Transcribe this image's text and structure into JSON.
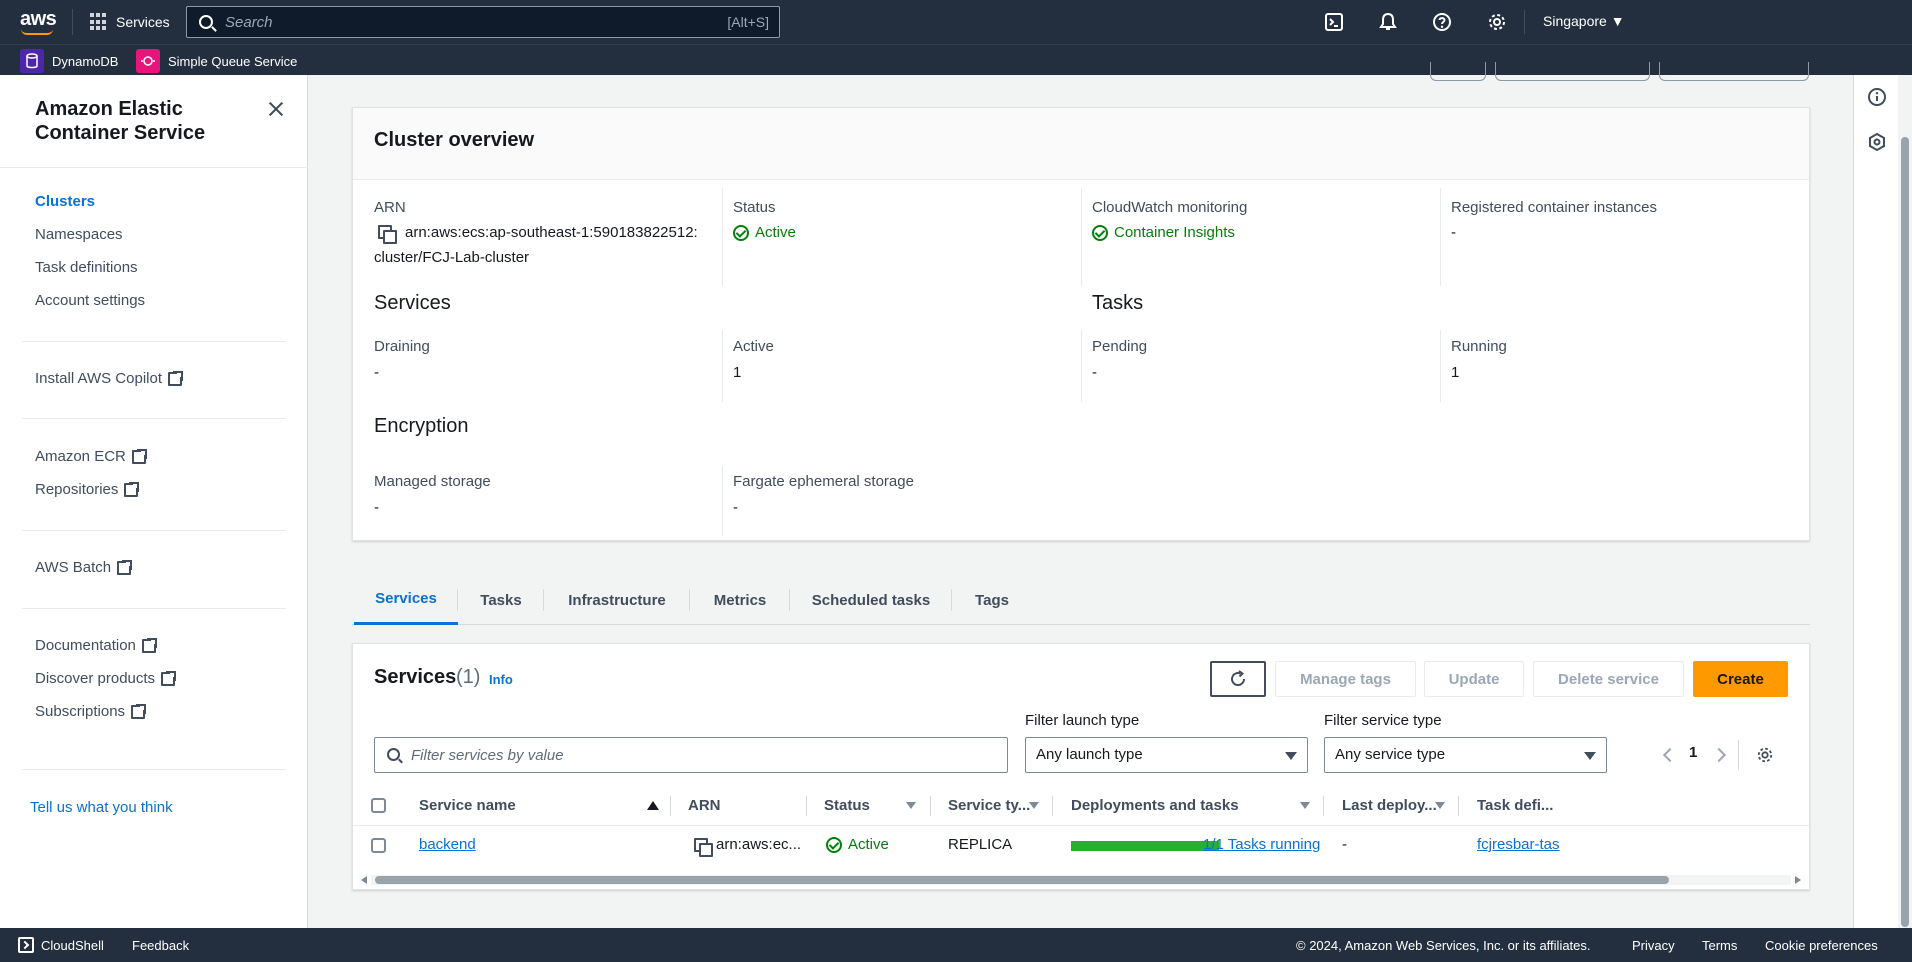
{
  "topnav": {
    "logo": "aws",
    "services_label": "Services",
    "search_placeholder": "Search",
    "search_shortcut": "[Alt+S]",
    "region": "Singapore ▼",
    "icons": [
      "cloudshell-icon",
      "bell-icon",
      "help-icon",
      "gear-icon"
    ]
  },
  "favorites": [
    {
      "label": "DynamoDB",
      "color": "#4d27aa"
    },
    {
      "label": "Simple Queue Service",
      "color": "#e7157b"
    }
  ],
  "sidebar": {
    "title": "Amazon Elastic Container Service",
    "nav": [
      "Clusters",
      "Namespaces",
      "Task definitions",
      "Account settings"
    ],
    "copilot": "Install AWS Copilot",
    "ecr": [
      "Amazon ECR",
      "Repositories"
    ],
    "batch": "AWS Batch",
    "resources": [
      "Documentation",
      "Discover products",
      "Subscriptions"
    ],
    "feedback": "Tell us what you think"
  },
  "overview": {
    "title": "Cluster overview",
    "arn_label": "ARN",
    "arn_value_1": "arn:aws:ecs:ap-southeast-1:590183822512:",
    "arn_value_2": "cluster/FCJ-Lab-cluster",
    "status_label": "Status",
    "status_value": "Active",
    "cloudwatch_label": "CloudWatch monitoring",
    "cloudwatch_value": "Container Insights",
    "registered_label": "Registered container instances",
    "registered_value": "-",
    "services_title": "Services",
    "draining_label": "Draining",
    "draining_value": "-",
    "active_label": "Active",
    "active_value": "1",
    "tasks_title": "Tasks",
    "pending_label": "Pending",
    "pending_value": "-",
    "running_label": "Running",
    "running_value": "1",
    "encryption_title": "Encryption",
    "managed_label": "Managed storage",
    "managed_value": "-",
    "fargate_label": "Fargate ephemeral storage",
    "fargate_value": "-"
  },
  "tabs": [
    "Services",
    "Tasks",
    "Infrastructure",
    "Metrics",
    "Scheduled tasks",
    "Tags"
  ],
  "services_table": {
    "title": "Services",
    "count": "(1)",
    "info": "Info",
    "buttons": {
      "manage_tags": "Manage tags",
      "update": "Update",
      "delete": "Delete service",
      "create": "Create"
    },
    "filter_placeholder": "Filter services by value",
    "filter_launch_label": "Filter launch type",
    "filter_launch_value": "Any launch type",
    "filter_service_label": "Filter service type",
    "filter_service_value": "Any service type",
    "page": "1",
    "columns": [
      "Service name",
      "ARN",
      "Status",
      "Service ty...",
      "Deployments and tasks",
      "Last deploy...",
      "Task defi..."
    ],
    "rows": [
      {
        "name": "backend",
        "arn": "arn:aws:ec...",
        "status": "Active",
        "service_type": "REPLICA",
        "deployment_progress": 1.0,
        "deployment_text": "1/1 Tasks running",
        "last_deployment": "-",
        "task_definition": "fcjresbar-tas"
      }
    ]
  },
  "footer": {
    "cloudshell": "CloudShell",
    "feedback": "Feedback",
    "copyright": "© 2024, Amazon Web Services, Inc. or its affiliates.",
    "privacy": "Privacy",
    "terms": "Terms",
    "cookies": "Cookie preferences"
  }
}
